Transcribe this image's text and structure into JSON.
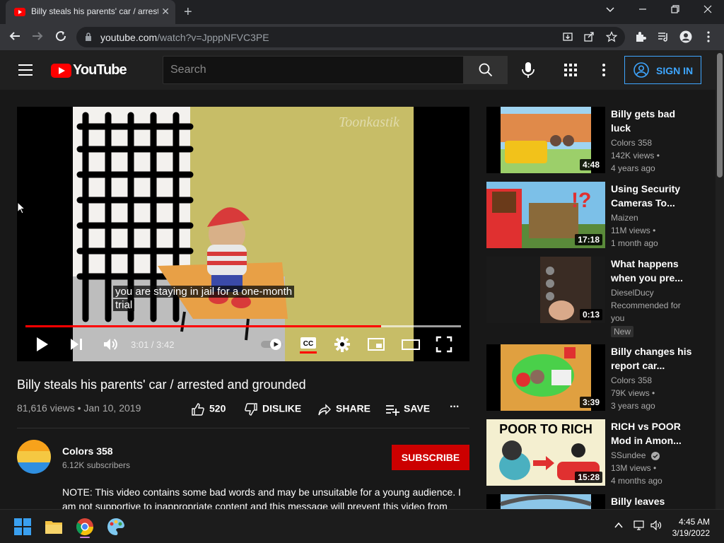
{
  "browser": {
    "tab_title": "Billy steals his parents' car / arrested",
    "tab_close": "✕",
    "new_tab": "+",
    "url_host": "youtube.com",
    "url_path": "/watch?v=JpppNFVC3PE"
  },
  "header": {
    "logo_text": "YouTube",
    "search_placeholder": "Search",
    "signin_label": "SIGN IN"
  },
  "player": {
    "subtitle_line1": "you are staying in jail for a one-month",
    "subtitle_line2": "trial",
    "time": "3:01 / 3:42",
    "watermark": "Toonkastik",
    "progress_fraction": 0.817,
    "buffered_fraction": 1.0
  },
  "video": {
    "title": "Billy steals his parents' car / arrested and grounded",
    "meta": "81,616 views • Jan 10, 2019",
    "likes": "520",
    "dislike_label": "DISLIKE",
    "share_label": "SHARE",
    "save_label": "SAVE",
    "more": "..."
  },
  "channel": {
    "name": "Colors 358",
    "subscribers": "6.12K subscribers",
    "subscribe_label": "SUBSCRIBE",
    "description": "NOTE: This video contains some bad words and may be unsuitable for a young audience. I am not supportive to inappropriate content and this message will prevent this video from"
  },
  "recommendations": [
    {
      "title": "Billy gets bad luck",
      "channel": "Colors 358",
      "views": "142K views •",
      "age": "4 years ago",
      "duration": "4:48"
    },
    {
      "title": "Using Security Cameras To...",
      "channel": "Maizen",
      "views": "11M views •",
      "age": "1 month ago",
      "duration": "17:18"
    },
    {
      "title": "What happens when you pre...",
      "channel": "DieselDucy",
      "views": "Recommended for",
      "age": "you",
      "duration": "0:13",
      "badge": "New"
    },
    {
      "title": "Billy changes his report car...",
      "channel": "Colors 358",
      "views": "79K views •",
      "age": "3 years ago",
      "duration": "3:39"
    },
    {
      "title": "RICH vs POOR Mod in Amon...",
      "channel": "SSundee",
      "views": "13M views •",
      "age": "4 months ago",
      "duration": "15:28",
      "thumb_text": "POOR TO RICH"
    },
    {
      "title": "Billy leaves"
    }
  ],
  "taskbar": {
    "time": "4:45 AM",
    "date": "3/19/2022"
  },
  "colors": {
    "accent_red": "#ff0000",
    "subscribe_red": "#cc0000",
    "signin_blue": "#3ea6ff"
  }
}
